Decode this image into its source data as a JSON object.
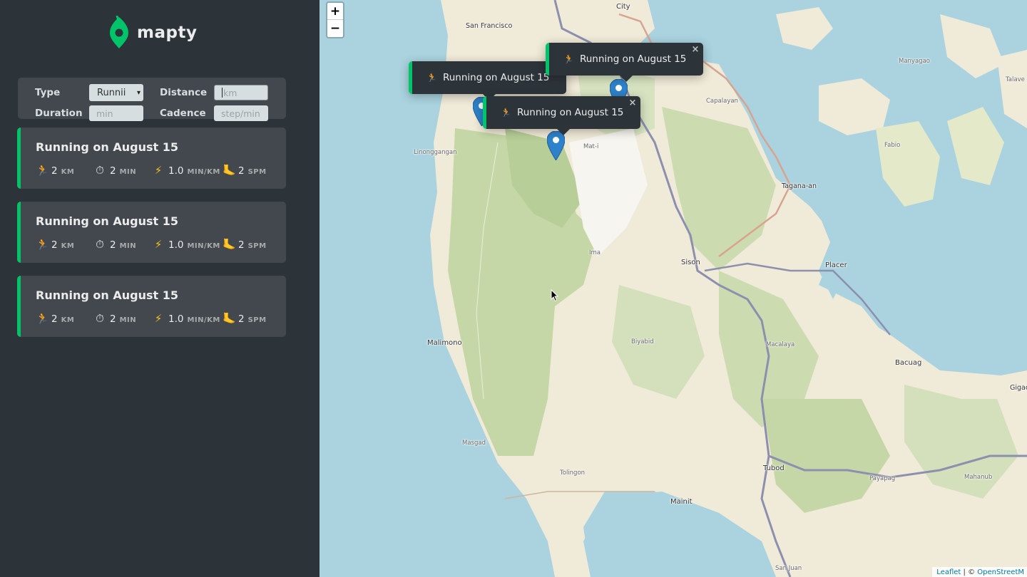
{
  "brand": {
    "name": "mapty",
    "logo_icon": "map-pin-icon",
    "accent": "#00c46a"
  },
  "form": {
    "type_label": "Type",
    "type_value": "Runnii",
    "distance_label": "Distance",
    "distance_placeholder": "km",
    "duration_label": "Duration",
    "duration_placeholder": "min",
    "cadence_label": "Cadence",
    "cadence_placeholder": "step/min"
  },
  "workouts": [
    {
      "title": "Running on August 15",
      "distance": "2",
      "distance_unit": "KM",
      "duration": "2",
      "duration_unit": "MIN",
      "pace": "1.0",
      "pace_unit": "MIN/KM",
      "cadence": "2",
      "cadence_unit": "SPM"
    },
    {
      "title": "Running on August 15",
      "distance": "2",
      "distance_unit": "KM",
      "duration": "2",
      "duration_unit": "MIN",
      "pace": "1.0",
      "pace_unit": "MIN/KM",
      "cadence": "2",
      "cadence_unit": "SPM"
    },
    {
      "title": "Running on August 15",
      "distance": "2",
      "distance_unit": "KM",
      "duration": "2",
      "duration_unit": "MIN",
      "pace": "1.0",
      "pace_unit": "MIN/KM",
      "cadence": "2",
      "cadence_unit": "SPM"
    }
  ],
  "map": {
    "zoom_in": "+",
    "zoom_out": "−",
    "popups": [
      {
        "text": "Running on August 15",
        "close": "×"
      },
      {
        "text": "Running on August 15",
        "close": "×"
      },
      {
        "text": "Running on August 15",
        "close": "×"
      }
    ],
    "places": [
      "City",
      "San Francisco",
      "Manyagao",
      "Talave",
      "Capalayan",
      "Fabio",
      "Linonggangan",
      "Mat-i",
      "Tagana-an",
      "Ima",
      "Sison",
      "Placer",
      "Malimono",
      "Biyabid",
      "Macalaya",
      "Bacuag",
      "Gigac",
      "Masgad",
      "Tolingon",
      "Tubod",
      "Mahanub",
      "Payapag",
      "Mainit",
      "San Juan"
    ],
    "attribution": {
      "leaflet": "Leaflet",
      "separator": " | © ",
      "osm": "OpenStreetM"
    }
  }
}
